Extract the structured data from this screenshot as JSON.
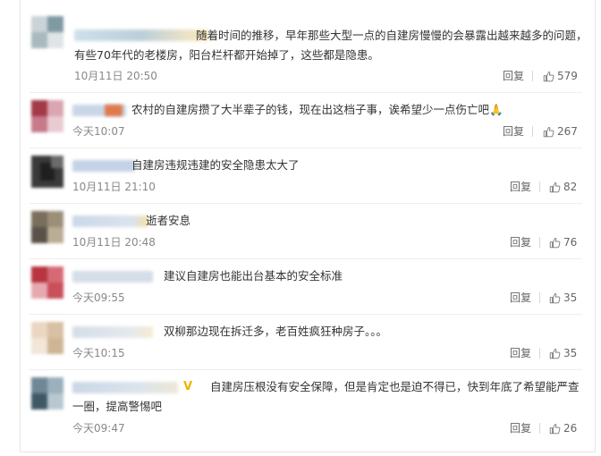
{
  "reply_label": "回复",
  "colors": {
    "text": "#333333",
    "time": "#888888",
    "badge": "#f0b400",
    "border": "#eeeeee"
  },
  "comments": [
    {
      "text": "随着时间的推移，早年那些大型一点的自建房慢慢的会暴露出越来越多的问题，有些70年代的老楼房，阳台栏杆都开始掉了，这些都是隐患。",
      "time": "10月11日 20:50",
      "likes": "579"
    },
    {
      "text": "农村的自建房攒了大半辈子的钱，现在出这档子事，诶希望少一点伤亡吧🙏",
      "time": "今天10:07",
      "likes": "267"
    },
    {
      "text": "自建房违规违建的安全隐患太大了",
      "time": "10月11日 21:10",
      "likes": "82"
    },
    {
      "text": "逝者安息",
      "time": "10月11日 20:48",
      "likes": "76"
    },
    {
      "text": "建议自建房也能出台基本的安全标准",
      "time": "今天09:55",
      "likes": "35"
    },
    {
      "text": "双柳那边现在拆迁多，老百姓疯狂种房子。。。",
      "time": "今天10:15",
      "likes": "35"
    },
    {
      "badge": "V",
      "text": "自建房压根没有安全保障，但是肯定也是迫不得已，快到年底了希望能严查一圈，提高警惕吧",
      "time": "今天09:47",
      "likes": "26"
    }
  ]
}
